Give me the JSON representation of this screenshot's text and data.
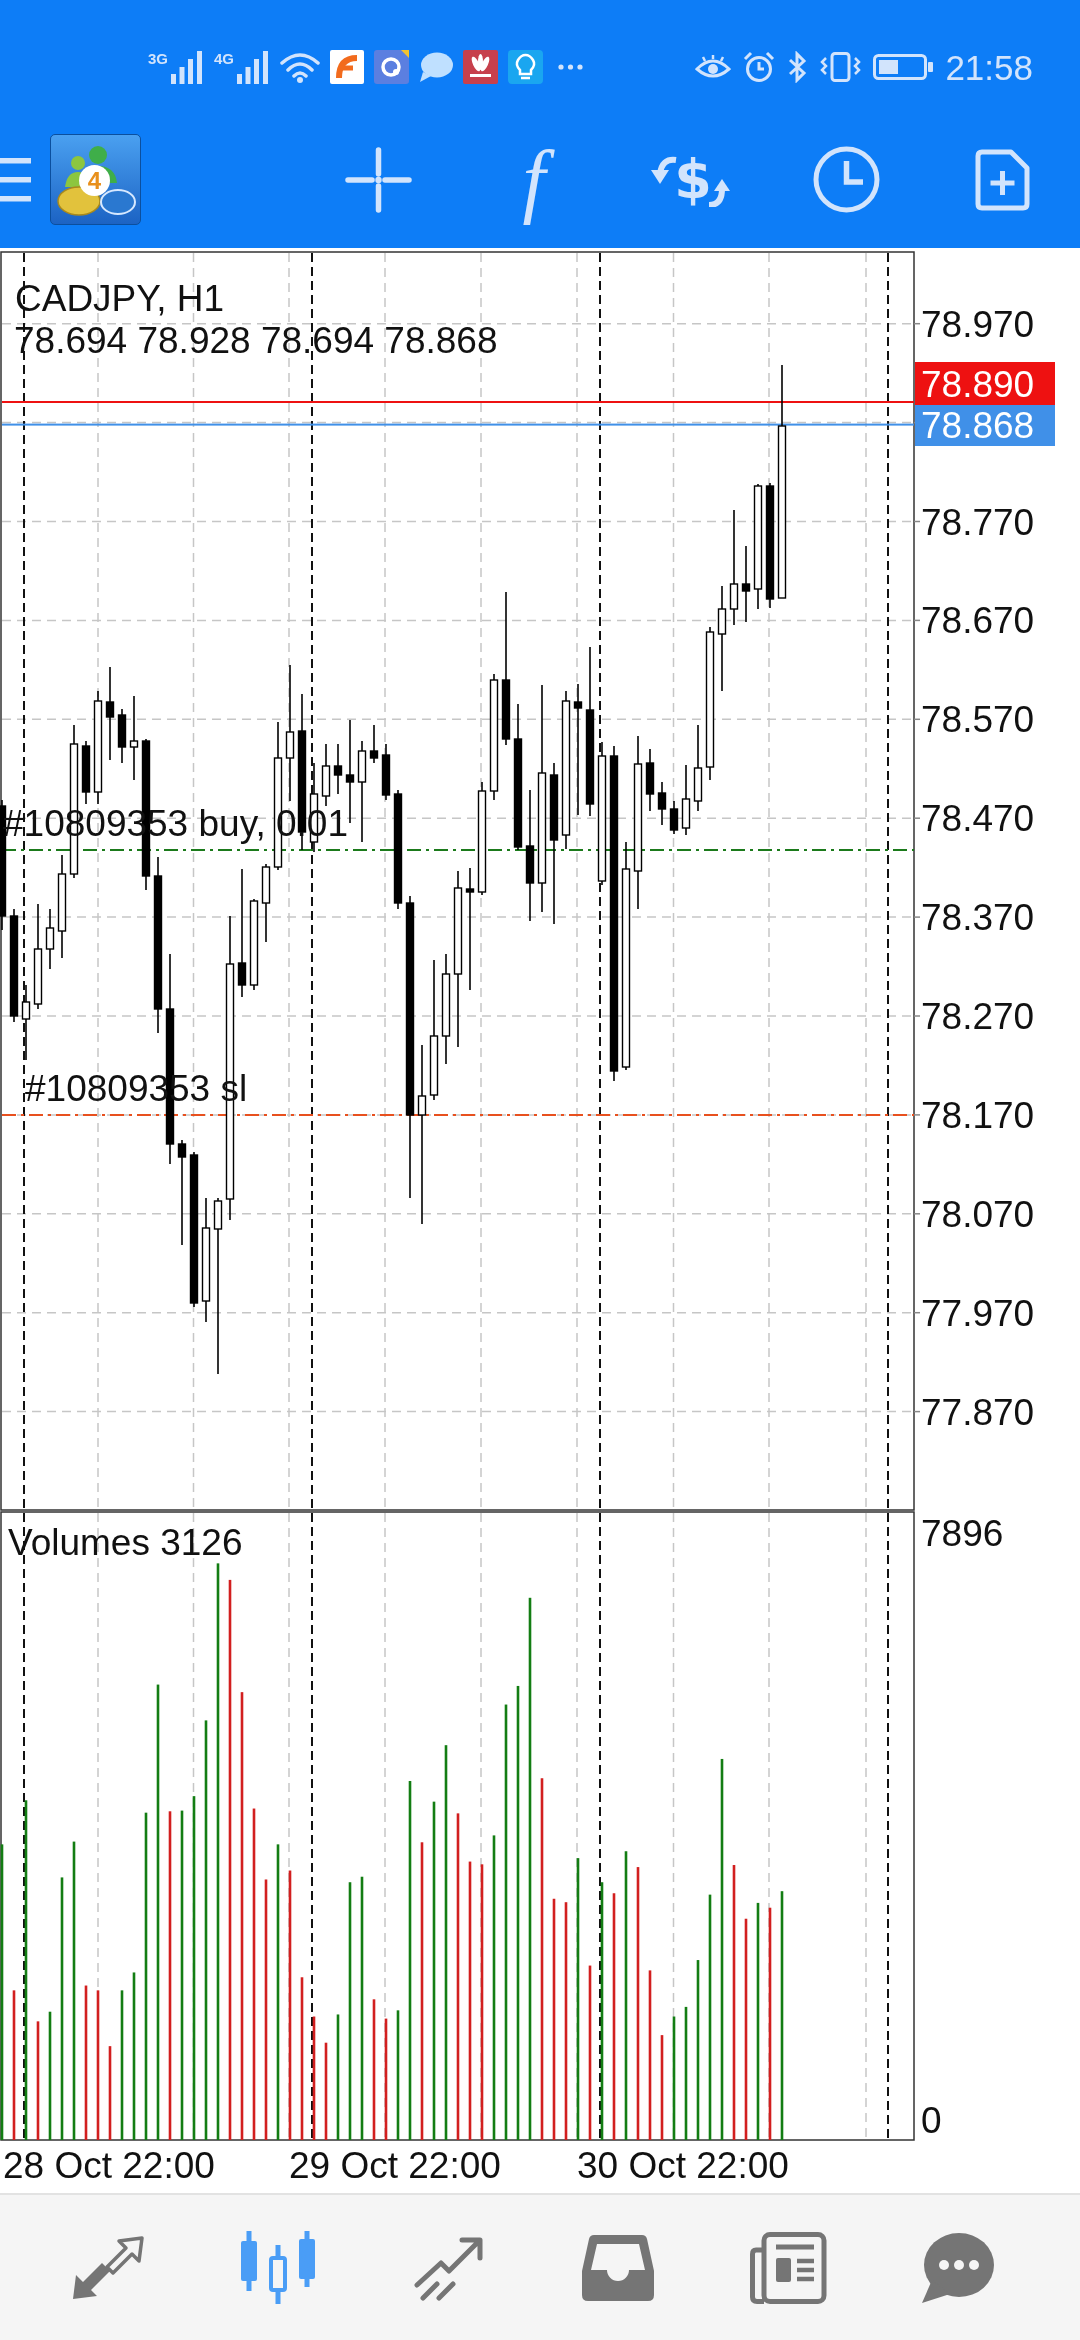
{
  "status_bar": {
    "networks": [
      {
        "label": "3G"
      },
      {
        "label": "4G"
      }
    ],
    "time": "21:58"
  },
  "toolbar": {
    "logo_badge": "4",
    "buttons": [
      {
        "kind": "crosshair"
      },
      {
        "kind": "indicators",
        "symbol": "f"
      },
      {
        "kind": "trade",
        "symbol": "$"
      },
      {
        "kind": "period"
      },
      {
        "kind": "new_document"
      }
    ]
  },
  "chart": {
    "symbol": "CADJPY, H1",
    "ohlc": "78.694 78.928 78.694 78.868",
    "price_ticks": [
      "78.970",
      "78.770",
      "78.670",
      "78.570",
      "78.470",
      "78.370",
      "78.270",
      "78.170",
      "78.070",
      "77.970",
      "77.870"
    ],
    "price_tags": [
      {
        "kind": "ask",
        "label": "78.890",
        "color": "#ee1111"
      },
      {
        "kind": "bid",
        "label": "78.868",
        "color": "#4090e8"
      }
    ],
    "order_lines": [
      {
        "kind": "buy",
        "label": "#10809353 buy, 0.01",
        "color": "#1b7a1b"
      },
      {
        "kind": "stop_loss",
        "label": "#10809353 sl",
        "color": "#e8501e"
      }
    ],
    "volumes": {
      "label": "Volumes 3126",
      "ticks": [
        "7896",
        "0"
      ]
    },
    "time_labels": [
      "28 Oct 22:00",
      "29 Oct 22:00",
      "30 Oct 22:00"
    ]
  },
  "bottom_nav": [
    {
      "kind": "quotes",
      "selected": false
    },
    {
      "kind": "chart",
      "selected": true
    },
    {
      "kind": "trade",
      "selected": false
    },
    {
      "kind": "history",
      "selected": false
    },
    {
      "kind": "news",
      "selected": false
    },
    {
      "kind": "chat",
      "selected": false
    }
  ]
}
